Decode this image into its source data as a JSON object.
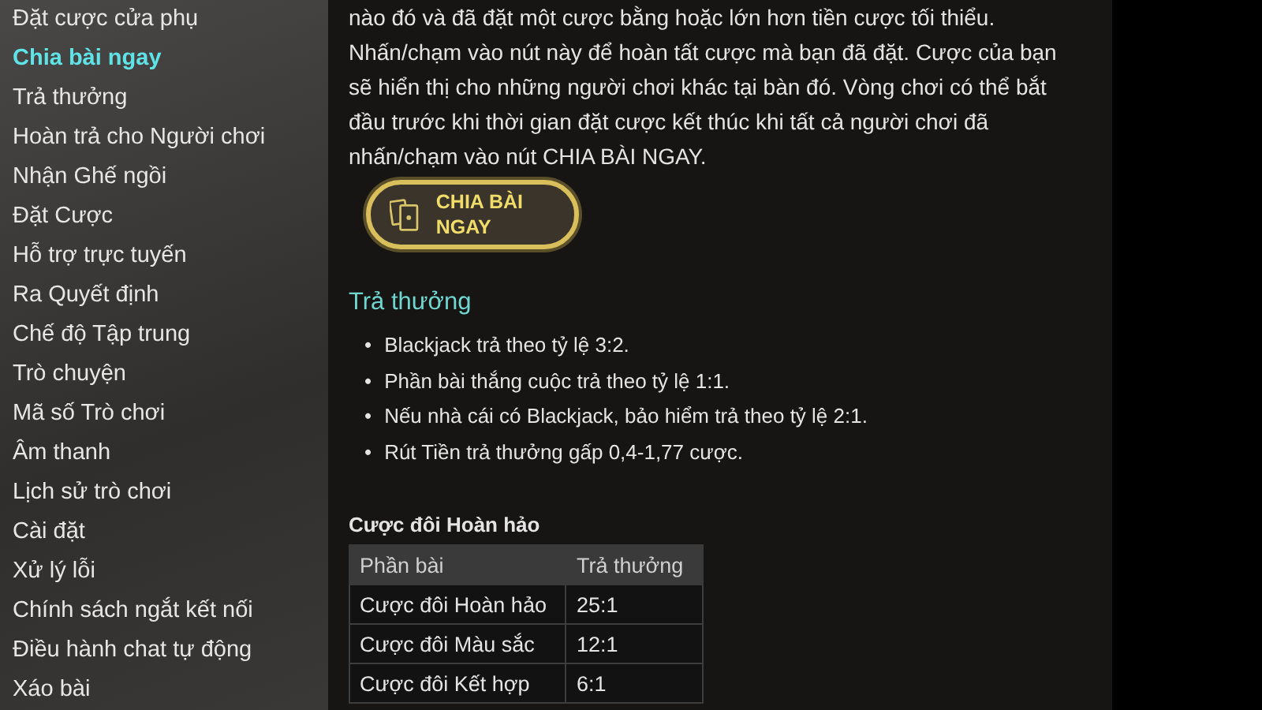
{
  "sidebar": {
    "items": [
      {
        "label": "Đặt cược cửa phụ",
        "selected": false
      },
      {
        "label": "Chia bài ngay",
        "selected": true
      },
      {
        "label": "Trả thưởng",
        "selected": false
      },
      {
        "label": "Hoàn trả cho Người chơi",
        "selected": false
      },
      {
        "label": "Nhận Ghế ngồi",
        "selected": false
      },
      {
        "label": "Đặt Cược",
        "selected": false
      },
      {
        "label": "Hỗ trợ trực tuyến",
        "selected": false
      },
      {
        "label": "Ra Quyết định",
        "selected": false
      },
      {
        "label": "Chế độ Tập trung",
        "selected": false
      },
      {
        "label": "Trò chuyện",
        "selected": false
      },
      {
        "label": "Mã số Trò chơi",
        "selected": false
      },
      {
        "label": "Âm thanh",
        "selected": false
      },
      {
        "label": "Lịch sử trò chơi",
        "selected": false
      },
      {
        "label": "Cài đặt",
        "selected": false
      },
      {
        "label": "Xử lý lỗi",
        "selected": false
      },
      {
        "label": "Chính sách ngắt kết nối",
        "selected": false
      },
      {
        "label": "Điều hành chat tự động",
        "selected": false
      },
      {
        "label": "Xáo bài",
        "selected": false
      }
    ]
  },
  "content": {
    "paragraph": "nào đó và đã đặt một cược bằng hoặc lớn hơn tiền cược tối thiểu. Nhấn/chạm vào nút này để hoàn tất cược mà bạn đã đặt. Cược của bạn sẽ hiển thị cho những người chơi khác tại bàn đó. Vòng chơi có thể bắt đầu trước khi thời gian đặt cược kết thúc khi tất cả người chơi đã nhấn/chạm vào nút CHIA BÀI NGAY.",
    "button": {
      "label": "CHIA BÀI NGAY"
    },
    "payout_heading": "Trả thưởng",
    "payout_bullets": [
      {
        "marker": "•",
        "text": "Blackjack trả theo tỷ lệ 3:2."
      },
      {
        "marker": "•",
        "text": "Phần bài thắng cuộc trả theo tỷ lệ 1:1."
      },
      {
        "marker": "•",
        "text": "Nếu nhà cái có Blackjack, bảo hiểm trả theo tỷ lệ 2:1."
      },
      {
        "marker": "•",
        "text": "Rút Tiền trả thưởng gấp 0,4-1,77 cược."
      }
    ],
    "table_title": "Cược đôi Hoàn hảo",
    "table": {
      "columns": [
        "Phần bài",
        "Trả thưởng"
      ],
      "rows": [
        [
          "Cược đôi Hoàn hảo",
          "25:1"
        ],
        [
          "Cược đôi Màu sắc",
          "12:1"
        ],
        [
          "Cược đôi Kết hợp",
          "6:1"
        ]
      ]
    }
  }
}
